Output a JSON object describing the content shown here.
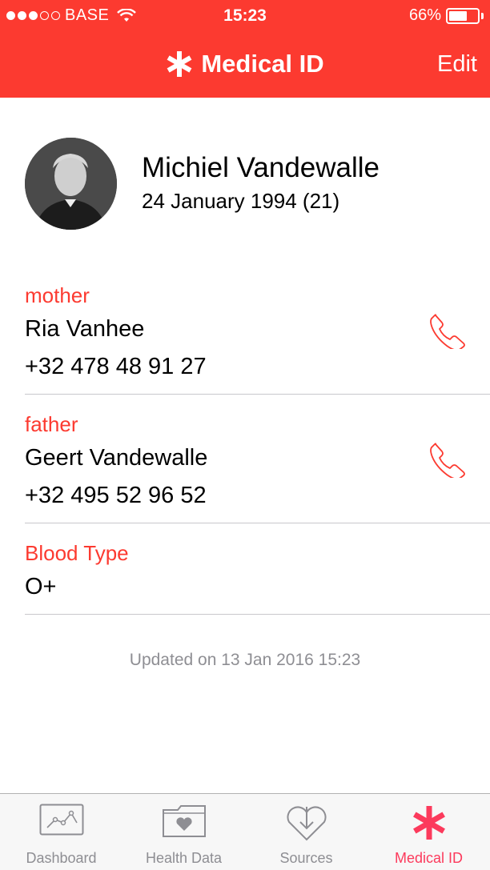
{
  "status_bar": {
    "carrier": "BASE",
    "time": "15:23",
    "battery": "66%",
    "battery_level": 0.66
  },
  "nav": {
    "title": "Medical ID",
    "edit_label": "Edit"
  },
  "profile": {
    "name": "Michiel Vandewalle",
    "dob": "24 January 1994 (21)"
  },
  "contacts": [
    {
      "relation": "mother",
      "name": "Ria Vanhee",
      "phone": "+32 478 48 91 27"
    },
    {
      "relation": "father",
      "name": "Geert Vandewalle",
      "phone": "+32 495 52 96 52"
    }
  ],
  "blood": {
    "label": "Blood Type",
    "value": "O+"
  },
  "updated": "Updated on 13 Jan 2016 15:23",
  "tabs": [
    {
      "label": "Dashboard",
      "icon": "dashboard-icon"
    },
    {
      "label": "Health Data",
      "icon": "health-data-icon"
    },
    {
      "label": "Sources",
      "icon": "sources-icon"
    },
    {
      "label": "Medical ID",
      "icon": "medical-id-icon",
      "active": true
    }
  ],
  "colors": {
    "accent": "#fc3a30",
    "tab_active": "#fc3a5c",
    "inactive": "#8e8e93"
  }
}
